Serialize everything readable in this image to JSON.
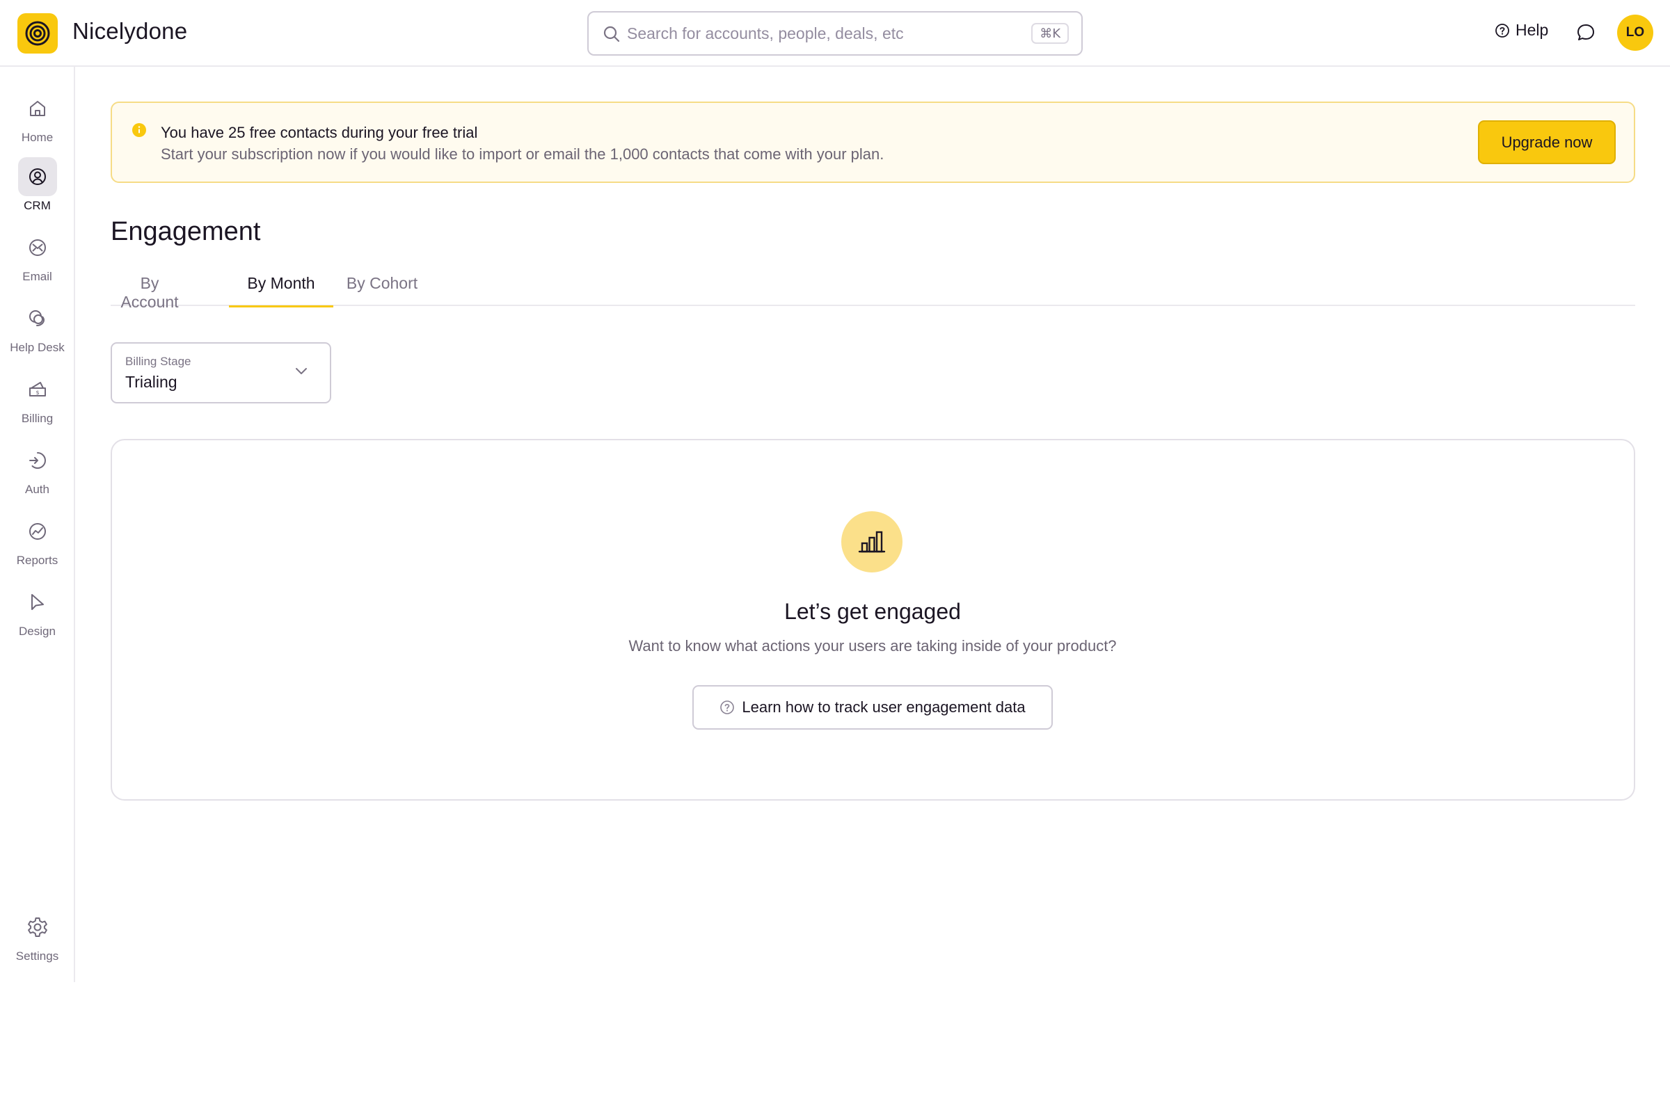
{
  "app": {
    "name": "Nicelydone"
  },
  "search": {
    "placeholder": "Search for accounts, people, deals, etc",
    "shortcut": "⌘K"
  },
  "header": {
    "help_label": "Help",
    "avatar_initials": "LO"
  },
  "sidebar": {
    "items": [
      {
        "label": "Home",
        "icon": "home-icon",
        "active": false
      },
      {
        "label": "CRM",
        "icon": "contact-icon",
        "active": true
      },
      {
        "label": "Email",
        "icon": "mail-icon",
        "active": false
      },
      {
        "label": "Help Desk",
        "icon": "chat-bubbles-icon",
        "active": false
      },
      {
        "label": "Billing",
        "icon": "wallet-icon",
        "active": false
      },
      {
        "label": "Auth",
        "icon": "key-icon",
        "active": false
      },
      {
        "label": "Reports",
        "icon": "chart-line-icon",
        "active": false
      },
      {
        "label": "Design",
        "icon": "cursor-icon",
        "active": false
      }
    ],
    "settings_label": "Settings"
  },
  "banner": {
    "title": "You have 25 free contacts during your free trial",
    "text": "Start your subscription now if you would like to import or email the 1,000 contacts that come with your plan.",
    "button_label": "Upgrade now"
  },
  "page": {
    "title": "Engagement"
  },
  "tabs": [
    {
      "label": "By Account",
      "active": false
    },
    {
      "label": "By Month",
      "active": true
    },
    {
      "label": "By Cohort",
      "active": false
    }
  ],
  "filter": {
    "label": "Billing Stage",
    "value": "Trialing"
  },
  "empty_state": {
    "title": "Let’s get engaged",
    "subtitle": "Want to know what actions your users are taking inside of your product?",
    "button_label": "Learn how to track user engagement data"
  },
  "colors": {
    "accent": "#f9c80e",
    "accent_light": "#fbe08a",
    "banner_bg": "#fffbef",
    "text": "#1b1523",
    "muted": "#6b6473"
  }
}
